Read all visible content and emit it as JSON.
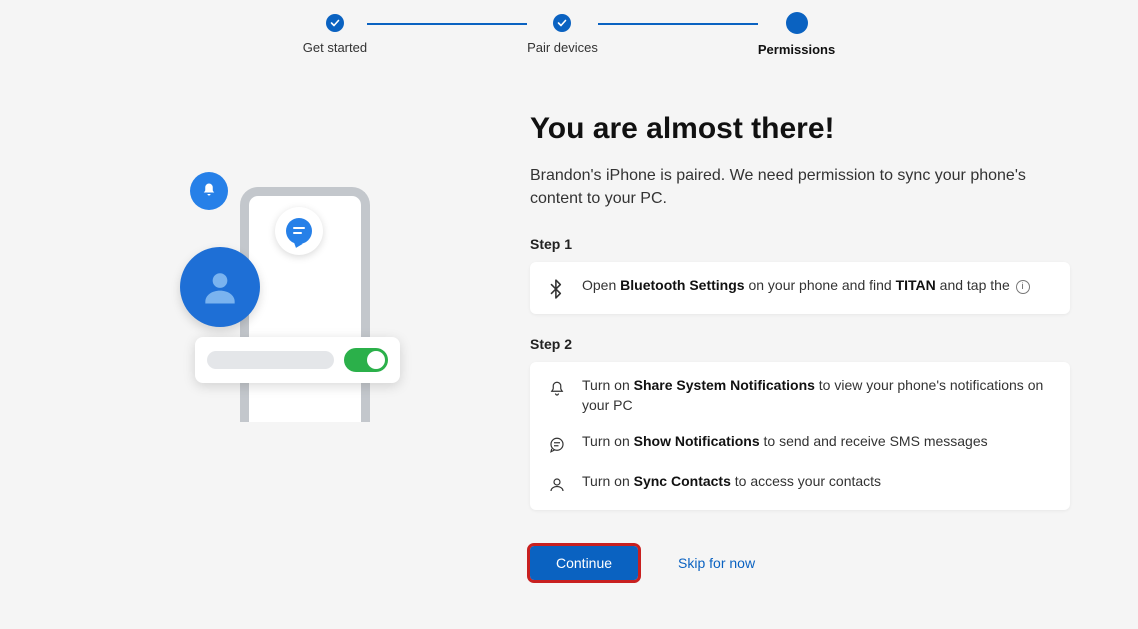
{
  "stepper": {
    "steps": [
      {
        "label": "Get started",
        "state": "done"
      },
      {
        "label": "Pair devices",
        "state": "done"
      },
      {
        "label": "Permissions",
        "state": "current"
      }
    ]
  },
  "heading": "You are almost there!",
  "subtext": "Brandon's iPhone is paired. We need permission to sync your phone's content to your PC.",
  "step1": {
    "title": "Step 1",
    "row": {
      "pre": "Open ",
      "b1": "Bluetooth Settings",
      "mid": " on your phone and find ",
      "b2": "TITAN",
      "post": " and tap the "
    }
  },
  "step2": {
    "title": "Step 2",
    "rows": [
      {
        "pre": "Turn on ",
        "bold": "Share System Notifications",
        "post": " to view your phone's notifications on your PC"
      },
      {
        "pre": "Turn on ",
        "bold": "Show Notifications",
        "post": " to send and receive SMS messages"
      },
      {
        "pre": "Turn on ",
        "bold": "Sync Contacts",
        "post": " to access your contacts"
      }
    ]
  },
  "buttons": {
    "continue": "Continue",
    "skip": "Skip for now"
  }
}
